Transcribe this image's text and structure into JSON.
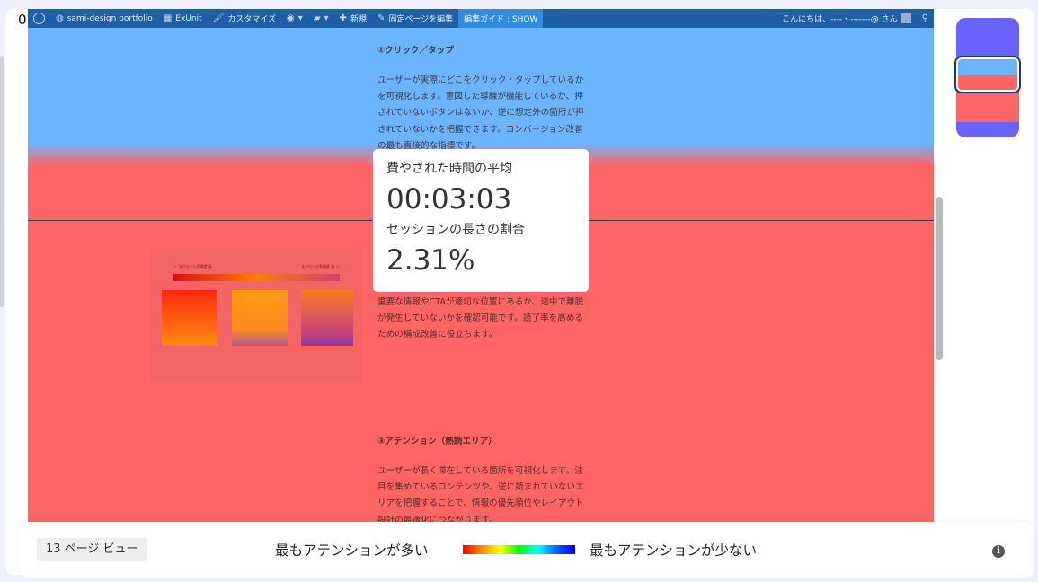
{
  "corner_label": "0",
  "admin_bar": {
    "site_name": "sami-design portfolio",
    "exunit": "ExUnit",
    "customize": "カスタマイズ",
    "new": "新規",
    "edit_page": "固定ページを編集",
    "edit_guide": "編集ガイド : SHOW",
    "greeting": "こんにちは、----・-------@ さん"
  },
  "article": {
    "section1_heading": "①クリック／タップ",
    "section1_body": "ユーザーが実際にどこをクリック・タップしているかを可視化します。意図した導線が機能しているか、押されていないボタンはないか、逆に想定外の箇所が押されていないかを把握できます。コンバージョン改善の最も直接的な指標です。",
    "section2_body": "重要な情報やCTAが適切な位置にあるか、途中で離脱が発生していないかを確認可能です。読了率を高めるための構成改善に役立ちます。",
    "section3_heading": "③アテンション（熟読エリア）",
    "section3_body": "ユーザーが長く滞在している箇所を可視化します。注目を集めているコンテンツや、逆に読まれていないエリアを把握することで、情報の優先順位やレイアウト設計の最適化につながります。"
  },
  "embedded_image": {
    "label_left": "← スクロール到達度 高",
    "label_right": "スクロール到達度 低 →"
  },
  "tooltip": {
    "avg_time_label": "費やされた時間の平均",
    "avg_time_value": "00:03:03",
    "session_ratio_label": "セッションの長さの割合",
    "session_ratio_value": "2.31%"
  },
  "legend": {
    "page_views": "13 ページ ビュー",
    "most_attention": "最もアテンションが多い",
    "least_attention": "最もアテンションが少ない",
    "info_icon": "i"
  },
  "colors": {
    "heat_high": "#ff6565",
    "heat_low": "#6bb5ff",
    "minimap_top": "#6a62ff",
    "admin_bar": "#1f5fa8"
  }
}
